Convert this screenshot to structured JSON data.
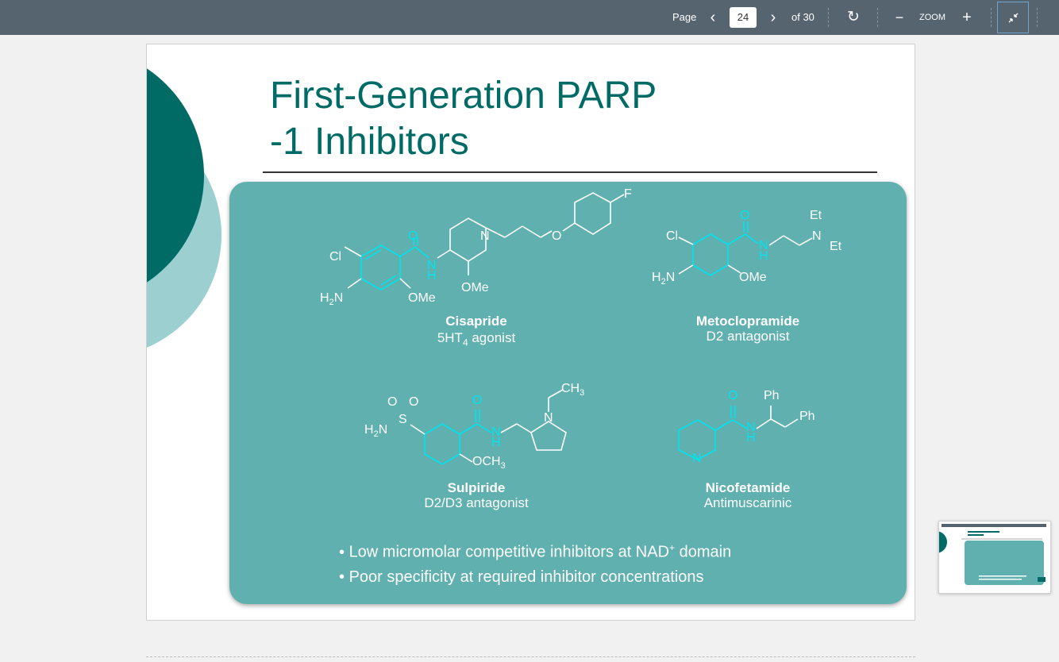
{
  "toolbar": {
    "page_label": "Page",
    "current_page": "24",
    "of_label": "of 30",
    "zoom_label": "ZOOM",
    "prev_icon": "chevron-left-icon",
    "next_icon": "chevron-right-icon",
    "rotate_icon": "rotate-icon",
    "zoom_out_icon": "minus-icon",
    "zoom_in_icon": "plus-icon",
    "fit_icon": "collapse-icon",
    "colors": {
      "bar": "#566470",
      "focus": "#6fa4cf"
    }
  },
  "slide": {
    "title_line1": "First-Generation PARP",
    "title_line2": "-1 Inhibitors",
    "colors": {
      "title": "#006b66",
      "panel": "#5fb0af",
      "highlight": "#00e5f0",
      "dark_circle": "#006a65",
      "light_circle": "#9ccfcf"
    },
    "drugs": [
      {
        "name": "Cisapride",
        "desc_main": "5HT",
        "desc_sub": "4",
        "desc_rest": " agonist",
        "labels": {
          "cl": "Cl",
          "h2n": "H",
          "h2n_sub": "2",
          "h2n_n": "N",
          "ome1": "OMe",
          "ome2": "OMe",
          "o": "O",
          "n": "N",
          "h": "H",
          "n_pip": "N",
          "o_ether": "O",
          "f": "F"
        }
      },
      {
        "name": "Metoclopramide",
        "desc": "D2 antagonist",
        "labels": {
          "cl": "Cl",
          "h2n": "H",
          "h2n_sub": "2",
          "h2n_n": "N",
          "ome": "OMe",
          "o": "O",
          "n": "N",
          "h": "H",
          "et1": "Et",
          "n2": "N",
          "et2": "Et"
        }
      },
      {
        "name": "Sulpiride",
        "desc": "D2/D3 antagonist",
        "labels": {
          "o1": "O",
          "o2": "O",
          "s": "S",
          "h2n": "H",
          "h2n_sub": "2",
          "h2n_n": "N",
          "och3": "OCH",
          "och3_sub": "3",
          "o": "O",
          "n": "N",
          "h": "H",
          "n_pyr": "N",
          "ch3": "CH",
          "ch3_sub": "3"
        }
      },
      {
        "name": "Nicofetamide",
        "desc": "Antimuscarinic",
        "labels": {
          "o": "O",
          "n": "N",
          "h": "H",
          "n_py": "N",
          "ph1": "Ph",
          "ph2": "Ph"
        }
      }
    ],
    "bullets": [
      {
        "text": "Low micromolar competitive inhibitors at NAD",
        "sup": "+",
        "rest": " domain"
      },
      {
        "text": "Poor specificity at required inhibitor concentrations"
      }
    ]
  }
}
